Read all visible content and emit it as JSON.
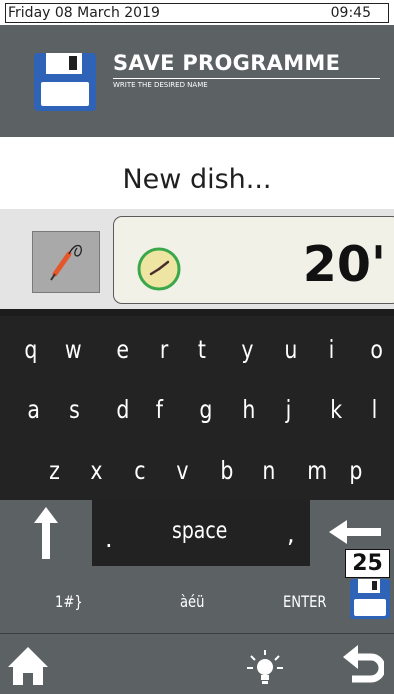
{
  "status": {
    "date": "Friday 08 March 2019",
    "time": "09:45"
  },
  "header": {
    "title": "SAVE PROGRAMME",
    "subtitle": "WRITE THE DESIRED NAME",
    "icon": "floppy-disk-icon"
  },
  "name_field": {
    "value": "New dish..."
  },
  "probe": {
    "icon": "core-probe-icon"
  },
  "timer": {
    "icon": "clock-icon",
    "value": "20'"
  },
  "keyboard": {
    "row1": [
      "q",
      "w",
      "e",
      "r",
      "t",
      "y",
      "u",
      "i",
      "o"
    ],
    "row2": [
      "a",
      "s",
      "d",
      "f",
      "g",
      "h",
      "j",
      "k",
      "l"
    ],
    "row3": [
      "z",
      "x",
      "c",
      "v",
      "b",
      "n",
      "m",
      "p"
    ],
    "dot": ".",
    "space": "space",
    "comma": ",",
    "symbols": "1#}",
    "accents": "àéü",
    "enter": "ENTER",
    "shift_icon": "shift-arrow-icon",
    "backspace_icon": "backspace-arrow-icon"
  },
  "counter": "25",
  "footer": {
    "home_icon": "home-icon",
    "light_icon": "light-bulb-icon",
    "back_icon": "back-arrow-icon"
  },
  "colors": {
    "header_bg": "#5c6164",
    "keyboard_bg": "#232323",
    "floppy_blue": "#2f63b8",
    "probe_orange": "#e5562a"
  }
}
